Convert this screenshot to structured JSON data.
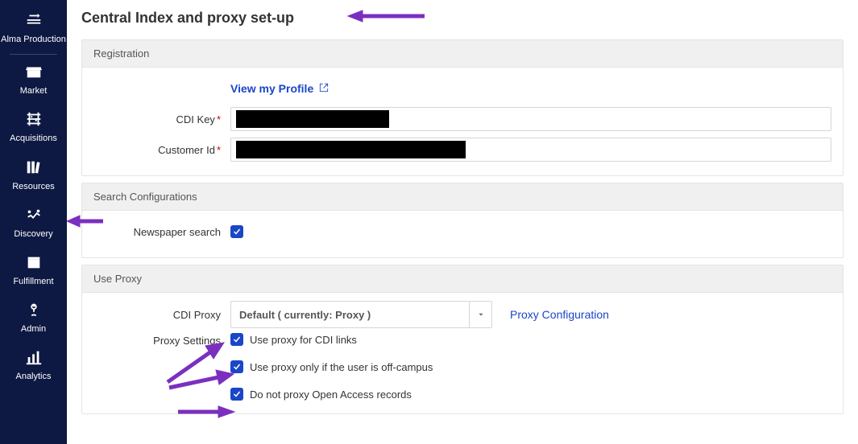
{
  "sidebar": {
    "items": [
      {
        "label": "Alma Production",
        "icon": "alma"
      },
      {
        "label": "Market",
        "icon": "market"
      },
      {
        "label": "Acquisitions",
        "icon": "acquisitions"
      },
      {
        "label": "Resources",
        "icon": "resources"
      },
      {
        "label": "Discovery",
        "icon": "discovery"
      },
      {
        "label": "Fulfillment",
        "icon": "fulfillment"
      },
      {
        "label": "Admin",
        "icon": "admin"
      },
      {
        "label": "Analytics",
        "icon": "analytics"
      }
    ]
  },
  "page": {
    "title": "Central Index and proxy set-up"
  },
  "sections": {
    "registration": {
      "header": "Registration",
      "view_profile": "View my Profile",
      "cdi_key_label": "CDI Key",
      "customer_id_label": "Customer Id"
    },
    "search": {
      "header": "Search Configurations",
      "newspaper_label": "Newspaper search",
      "newspaper_checked": true
    },
    "proxy": {
      "header": "Use Proxy",
      "cdi_proxy_label": "CDI Proxy",
      "cdi_proxy_value": "Default ( currently: Proxy )",
      "config_link": "Proxy Configuration",
      "settings_label": "Proxy Settings",
      "opts": [
        {
          "label": "Use proxy for CDI links",
          "checked": true
        },
        {
          "label": "Use proxy only if the user is off-campus",
          "checked": true
        },
        {
          "label": "Do not proxy Open Access records",
          "checked": true
        }
      ]
    }
  }
}
